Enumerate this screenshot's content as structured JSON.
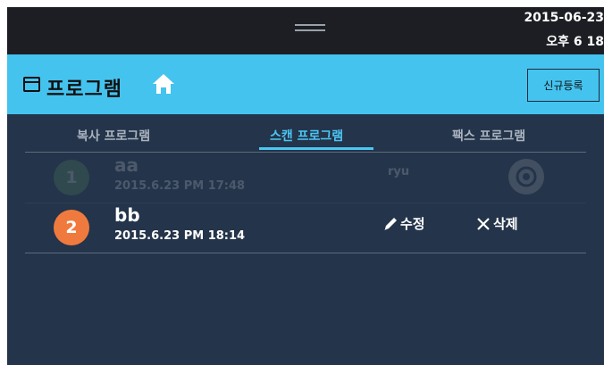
{
  "status": {
    "date": "2015-06-23",
    "time": "오후 6  18"
  },
  "header": {
    "title": "프로그램",
    "new_button": "신규등록"
  },
  "tabs": [
    {
      "label": "복사 프로그램",
      "active": false
    },
    {
      "label": "스캔 프로그램",
      "active": true
    },
    {
      "label": "팩스 프로그램",
      "active": false
    }
  ],
  "programs": [
    {
      "number": "1",
      "name": "aa",
      "datetime": "2015.6.23 PM 17:48",
      "user": "ryu",
      "state": "disabled"
    },
    {
      "number": "2",
      "name": "bb",
      "datetime": "2015.6.23 PM 18:14",
      "edit_label": "수정",
      "delete_label": "삭제",
      "state": "active"
    }
  ],
  "icons": {
    "window": "window-icon",
    "home": "home-icon",
    "gear": "gear-icon",
    "edit": "pencil-icon",
    "delete": "close-icon"
  },
  "colors": {
    "header": "#45c3ef",
    "background": "#24344a",
    "accent": "#4cc6f4",
    "badge": "#f07a3e"
  }
}
